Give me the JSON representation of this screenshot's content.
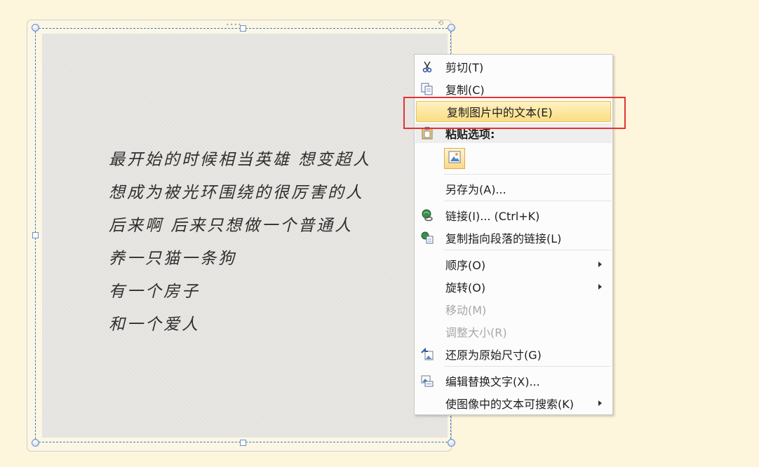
{
  "poem": {
    "lines": [
      "最开始的时候相当英雄 想变超人",
      "想成为被光环围绕的很厉害的人",
      "后来啊 后来只想做一个普通人",
      "养一只猫一条狗",
      "有一个房子",
      "和一个爱人"
    ]
  },
  "menu": {
    "cut": "剪切(T)",
    "copy": "复制(C)",
    "copy_text_from_picture": "复制图片中的文本(E)",
    "paste_options_header": "粘贴选项:",
    "save_as": "另存为(A)...",
    "link": "链接(I)... (Ctrl+K)",
    "copy_link_to_paragraph": "复制指向段落的链接(L)",
    "order": "顺序(O)",
    "rotate": "旋转(O)",
    "move": "移动(M)",
    "resize": "调整大小(R)",
    "restore_original_size": "还原为原始尺寸(G)",
    "edit_alt_text": "编辑替换文字(X)...",
    "make_text_searchable": "使图像中的文本可搜索(K)"
  },
  "colors": {
    "page_background": "#fdf6dc",
    "selection_border": "#4a78c2",
    "highlight_item": "#fbdd82",
    "annotation_box": "#e53232"
  }
}
